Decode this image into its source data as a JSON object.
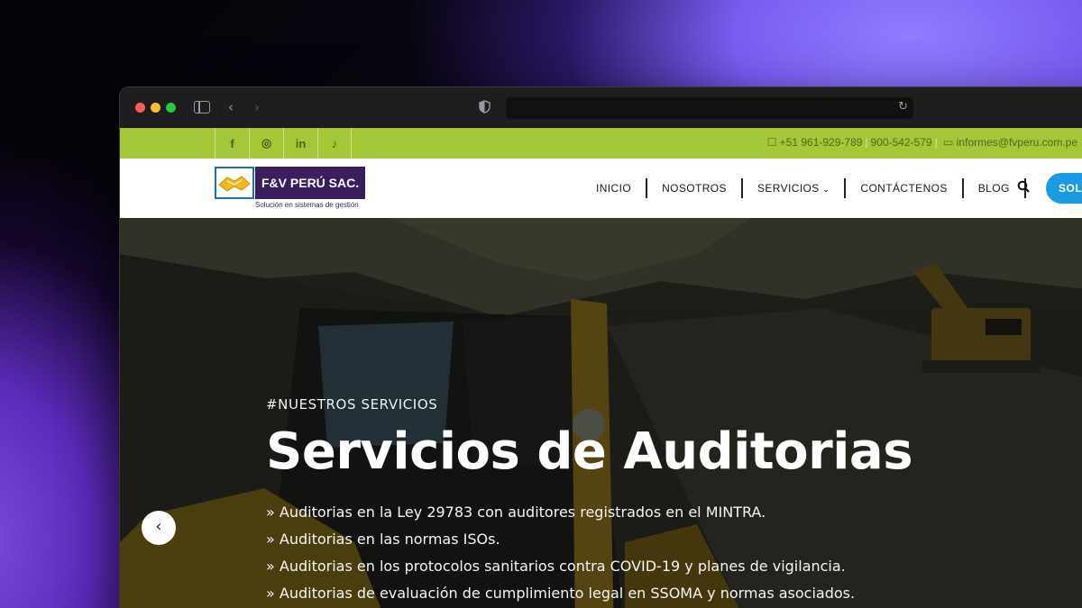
{
  "topbar": {
    "social": [
      {
        "icon": "facebook-icon",
        "glyph": "f"
      },
      {
        "icon": "instagram-icon",
        "glyph": "◎"
      },
      {
        "icon": "linkedin-icon",
        "glyph": "in"
      },
      {
        "icon": "tiktok-icon",
        "glyph": "♪"
      }
    ],
    "phone": "+51 961-929-789",
    "phone2": "900-542-579",
    "email": "informes@fvperu.com.pe"
  },
  "logo": {
    "name": "F&V PERÚ SAC.",
    "tagline": "Solución en sistemas de gestión"
  },
  "menu": {
    "items": [
      "INICIO",
      "NOSOTROS",
      "SERVICIOS",
      "CONTÁCTENOS",
      "BLOG"
    ],
    "cta": "SOLI"
  },
  "hero": {
    "kicker": "#NUESTROS SERVICIOS",
    "title": "Servicios de Auditorias",
    "bullets": [
      "» Auditorias en la Ley 29783 con auditores registrados en el MINTRA.",
      "» Auditorias en las normas ISOs.",
      "» Auditorias en los protocolos sanitarios contra COVID-19 y planes de vigilancia.",
      "» Auditorias de evaluación de cumplimiento legal en SSOMA y normas asociados."
    ],
    "prev_arrow": "‹"
  },
  "colors": {
    "topbar": "#a4c639",
    "logo_bg": "#3a1d5c",
    "cta": "#1b9ae3"
  }
}
